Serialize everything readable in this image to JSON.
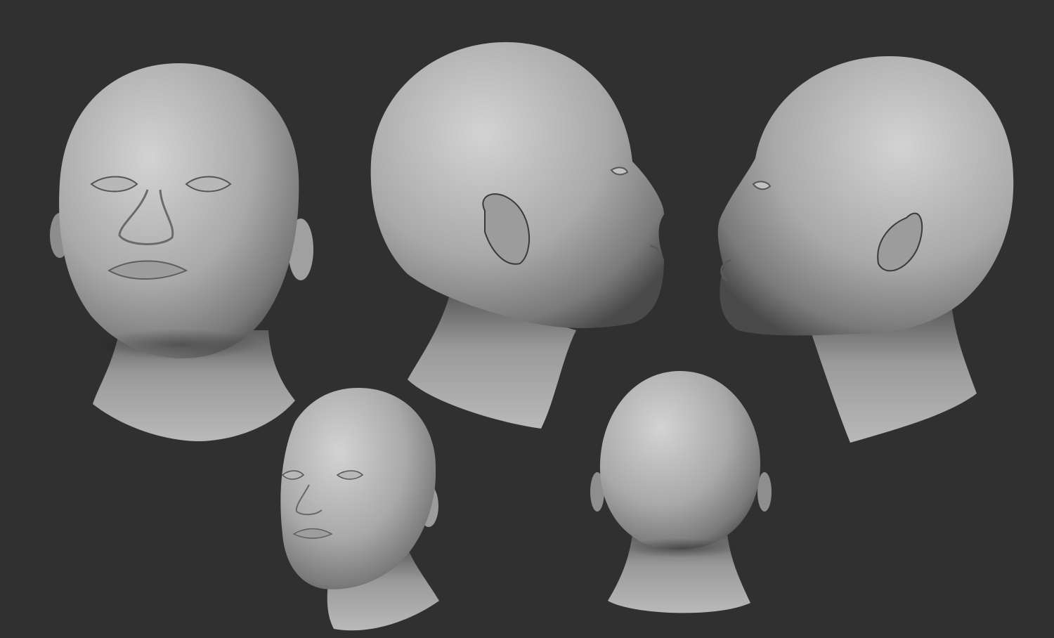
{
  "viewport": {
    "background": "#303030",
    "material_light": "#d2d2d2",
    "material_mid": "#8e8e8e",
    "material_dark": "#3a3a3a"
  },
  "renders": [
    {
      "view": "front"
    },
    {
      "view": "right-profile"
    },
    {
      "view": "left-profile"
    },
    {
      "view": "three-quarter"
    },
    {
      "view": "back"
    }
  ]
}
